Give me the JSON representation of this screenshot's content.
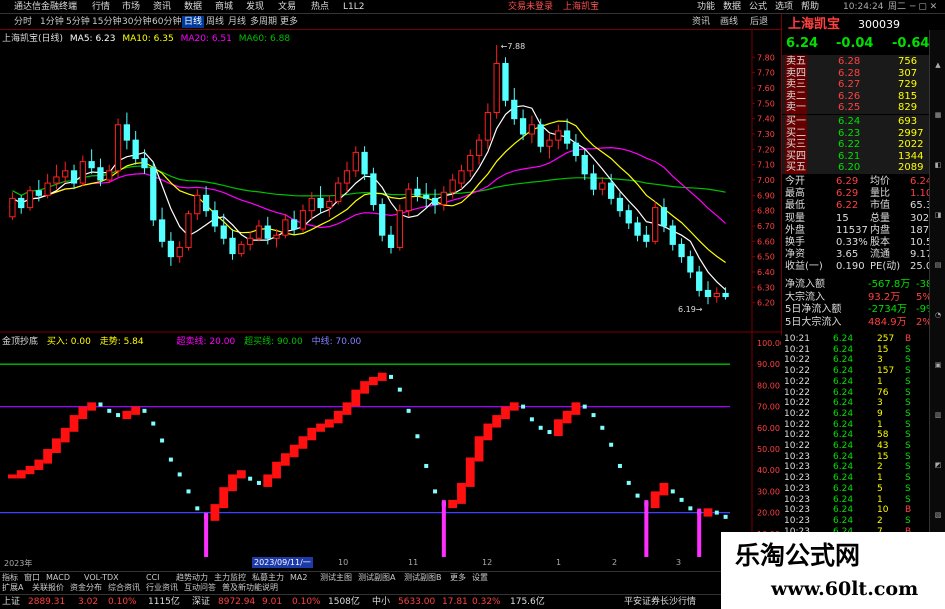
{
  "titlebar": {
    "app_name": "通达信金融终端",
    "menus": [
      "行情",
      "市场",
      "资讯",
      "数据",
      "商城",
      "发现",
      "文易",
      "热点",
      "L1L2"
    ],
    "center": [
      "交易未登录",
      "上海凯宝"
    ],
    "right": [
      "功能",
      "数据",
      "公式",
      "选项",
      "帮助"
    ],
    "time": "10:24:24",
    "weekday": "周二"
  },
  "toolbar": {
    "periods": [
      "分时",
      "1分钟",
      "5分钟",
      "15分钟",
      "30分钟",
      "60分钟",
      "日线",
      "周线",
      "月线",
      "多周期",
      "更多"
    ],
    "active": "日线",
    "right": [
      "资讯",
      "画线",
      "后退"
    ]
  },
  "chart_header": {
    "title": "上海凯宝(日线)",
    "ma5": "MA5: 6.23",
    "ma10": "MA10: 6.35",
    "ma20": "MA20: 6.51",
    "ma60": "MA60: 6.88"
  },
  "chart_data": [
    {
      "type": "candlestick",
      "symbol": "上海凯宝",
      "period": "日线",
      "ylim": [
        6.1,
        7.9
      ],
      "y_ticks": [
        "7.80",
        "7.70",
        "7.60",
        "7.50",
        "7.40",
        "7.30",
        "7.20",
        "7.10",
        "7.00",
        "6.90",
        "6.80",
        "6.70",
        "6.60",
        "6.50",
        "6.40",
        "6.30",
        "6.20"
      ],
      "annotations": {
        "high": "7.88",
        "low": "6.19"
      },
      "colors": {
        "up": "#ff2020",
        "down": "#54ffff",
        "ma5": "#ffffff",
        "ma10": "#ffff00",
        "ma20": "#ff00ff",
        "ma60": "#00c000"
      },
      "ohlc": [
        [
          6.76,
          6.92,
          6.74,
          6.88
        ],
        [
          6.88,
          6.9,
          6.78,
          6.82
        ],
        [
          6.82,
          6.96,
          6.8,
          6.93
        ],
        [
          6.93,
          7.0,
          6.86,
          6.9
        ],
        [
          6.9,
          7.04,
          6.88,
          6.98
        ],
        [
          6.98,
          7.1,
          6.94,
          7.02
        ],
        [
          7.02,
          7.12,
          6.98,
          7.06
        ],
        [
          7.06,
          7.1,
          6.94,
          6.98
        ],
        [
          6.98,
          7.16,
          6.96,
          7.12
        ],
        [
          7.12,
          7.2,
          7.04,
          7.08
        ],
        [
          7.08,
          7.14,
          6.96,
          7.0
        ],
        [
          7.0,
          7.1,
          6.98,
          7.06
        ],
        [
          7.06,
          7.4,
          7.02,
          7.36
        ],
        [
          7.36,
          7.44,
          7.2,
          7.26
        ],
        [
          7.26,
          7.32,
          7.1,
          7.14
        ],
        [
          7.14,
          7.2,
          7.04,
          7.08
        ],
        [
          7.08,
          7.12,
          6.7,
          6.74
        ],
        [
          6.74,
          6.82,
          6.56,
          6.6
        ],
        [
          6.6,
          6.66,
          6.44,
          6.5
        ],
        [
          6.5,
          6.6,
          6.46,
          6.56
        ],
        [
          6.56,
          6.8,
          6.54,
          6.78
        ],
        [
          6.78,
          6.94,
          6.74,
          6.9
        ],
        [
          6.9,
          6.96,
          6.76,
          6.8
        ],
        [
          6.8,
          6.86,
          6.66,
          6.7
        ],
        [
          6.7,
          6.78,
          6.58,
          6.62
        ],
        [
          6.62,
          6.68,
          6.48,
          6.52
        ],
        [
          6.52,
          6.6,
          6.5,
          6.58
        ],
        [
          6.58,
          6.66,
          6.54,
          6.62
        ],
        [
          6.62,
          6.74,
          6.6,
          6.7
        ],
        [
          6.7,
          6.76,
          6.58,
          6.62
        ],
        [
          6.62,
          6.68,
          6.56,
          6.64
        ],
        [
          6.64,
          6.78,
          6.62,
          6.74
        ],
        [
          6.74,
          6.8,
          6.64,
          6.68
        ],
        [
          6.68,
          6.84,
          6.66,
          6.8
        ],
        [
          6.8,
          6.92,
          6.74,
          6.88
        ],
        [
          6.88,
          6.96,
          6.78,
          6.82
        ],
        [
          6.82,
          6.9,
          6.76,
          6.86
        ],
        [
          6.86,
          7.02,
          6.84,
          6.98
        ],
        [
          6.98,
          7.12,
          6.92,
          7.06
        ],
        [
          7.06,
          7.22,
          7.02,
          7.18
        ],
        [
          7.18,
          7.22,
          7.0,
          7.04
        ],
        [
          7.04,
          7.08,
          6.8,
          6.84
        ],
        [
          6.84,
          6.88,
          6.6,
          6.64
        ],
        [
          6.64,
          6.7,
          6.52,
          6.56
        ],
        [
          6.56,
          6.84,
          6.54,
          6.8
        ],
        [
          6.8,
          6.98,
          6.76,
          6.94
        ],
        [
          6.94,
          7.02,
          6.86,
          6.9
        ],
        [
          6.9,
          6.98,
          6.82,
          6.88
        ],
        [
          6.88,
          6.94,
          6.78,
          6.84
        ],
        [
          6.84,
          6.96,
          6.8,
          6.92
        ],
        [
          6.92,
          7.04,
          6.88,
          7.0
        ],
        [
          6.98,
          7.1,
          6.94,
          7.06
        ],
        [
          7.06,
          7.2,
          7.02,
          7.16
        ],
        [
          7.16,
          7.3,
          7.1,
          7.26
        ],
        [
          7.26,
          7.5,
          7.2,
          7.44
        ],
        [
          7.44,
          7.88,
          7.4,
          7.76
        ],
        [
          7.76,
          7.8,
          7.48,
          7.52
        ],
        [
          7.52,
          7.6,
          7.36,
          7.4
        ],
        [
          7.4,
          7.46,
          7.26,
          7.3
        ],
        [
          7.3,
          7.42,
          7.24,
          7.36
        ],
        [
          7.36,
          7.4,
          7.18,
          7.22
        ],
        [
          7.22,
          7.3,
          7.14,
          7.26
        ],
        [
          7.26,
          7.36,
          7.2,
          7.32
        ],
        [
          7.32,
          7.4,
          7.2,
          7.24
        ],
        [
          7.24,
          7.3,
          7.12,
          7.16
        ],
        [
          7.16,
          7.2,
          7.0,
          7.04
        ],
        [
          7.04,
          7.1,
          6.9,
          6.94
        ],
        [
          6.94,
          7.02,
          6.9,
          6.98
        ],
        [
          6.98,
          7.04,
          6.84,
          6.88
        ],
        [
          6.88,
          6.92,
          6.76,
          6.8
        ],
        [
          6.8,
          6.84,
          6.68,
          6.72
        ],
        [
          6.72,
          6.76,
          6.6,
          6.64
        ],
        [
          6.64,
          6.7,
          6.56,
          6.6
        ],
        [
          6.6,
          6.86,
          6.58,
          6.82
        ],
        [
          6.82,
          6.88,
          6.66,
          6.7
        ],
        [
          6.7,
          6.74,
          6.54,
          6.58
        ],
        [
          6.58,
          6.62,
          6.46,
          6.5
        ],
        [
          6.5,
          6.54,
          6.36,
          6.4
        ],
        [
          6.4,
          6.44,
          6.24,
          6.28
        ],
        [
          6.28,
          6.34,
          6.19,
          6.24
        ],
        [
          6.24,
          6.3,
          6.2,
          6.26
        ],
        [
          6.26,
          6.3,
          6.22,
          6.24
        ]
      ]
    },
    {
      "type": "indicator",
      "name": "金顶抄底",
      "labels": [
        "买入: 0.00",
        "走势: 5.84",
        "超卖线: 20.00",
        "超买线: 90.00",
        "中线: 70.00"
      ],
      "header_colors": {
        "buy": "#ffff00",
        "trend": "#ffff00",
        "l20": "#ff00ff",
        "l90": "#00c000",
        "l70": "#8080ff"
      },
      "ylim": [
        0,
        100
      ],
      "y_ticks": [
        "100.00",
        "90.00",
        "80.00",
        "70.00",
        "60.00",
        "50.00",
        "40.00",
        "30.00",
        "20.00",
        "10.00"
      ],
      "lines": [
        {
          "value": 90,
          "color": "#00c000"
        },
        {
          "value": 70,
          "color": "#a000ff"
        },
        {
          "value": 20,
          "color": "#4040ff"
        }
      ],
      "trend": [
        38,
        40,
        42,
        45,
        50,
        55,
        60,
        66,
        70,
        72,
        71,
        68,
        66,
        68,
        70,
        68,
        62,
        54,
        45,
        38,
        30,
        22,
        18,
        24,
        32,
        38,
        40,
        36,
        34,
        38,
        44,
        48,
        52,
        56,
        60,
        62,
        64,
        68,
        72,
        78,
        82,
        84,
        86,
        84,
        78,
        68,
        56,
        42,
        30,
        24,
        26,
        34,
        46,
        56,
        62,
        66,
        70,
        72,
        70,
        64,
        60,
        58,
        64,
        68,
        72,
        70,
        66,
        60,
        52,
        42,
        34,
        28,
        24,
        30,
        34,
        30,
        26,
        22,
        20,
        22,
        20,
        18
      ]
    }
  ],
  "quote": {
    "name": "上海凯宝",
    "code": "300039",
    "price": "6.24",
    "change": "-0.04",
    "pct": "-0.64%",
    "sell": [
      {
        "label": "卖五",
        "price": "6.28",
        "vol": "756"
      },
      {
        "label": "卖四",
        "price": "6.28",
        "vol": "307"
      },
      {
        "label": "卖三",
        "price": "6.27",
        "vol": "729"
      },
      {
        "label": "卖二",
        "price": "6.26",
        "vol": "815"
      },
      {
        "label": "卖一",
        "price": "6.25",
        "vol": "829"
      }
    ],
    "buy": [
      {
        "label": "买一",
        "price": "6.24",
        "vol": "693"
      },
      {
        "label": "买二",
        "price": "6.23",
        "vol": "2997"
      },
      {
        "label": "买三",
        "price": "6.22",
        "vol": "2022"
      },
      {
        "label": "买四",
        "price": "6.21",
        "vol": "1344"
      },
      {
        "label": "买五",
        "price": "6.20",
        "vol": "2089"
      }
    ],
    "stats": [
      {
        "l": "今开",
        "v": "6.29",
        "l2": "均价",
        "v2": "6.24"
      },
      {
        "l": "最高",
        "v": "6.29",
        "l2": "量比",
        "v2": "1.10"
      },
      {
        "l": "最低",
        "v": "6.22",
        "l2": "市值",
        "v2": "65.3亿"
      },
      {
        "l": "现量",
        "v": "15",
        "l2": "总量",
        "v2": "30251"
      },
      {
        "l": "外盘",
        "v": "11537",
        "l2": "内盘",
        "v2": "18714"
      },
      {
        "l": "换手",
        "v": "0.33%",
        "l2": "股本",
        "v2": "10.5亿"
      },
      {
        "l": "净资",
        "v": "3.65",
        "l2": "流通",
        "v2": "9.17亿"
      },
      {
        "l": "收益(一)",
        "v": "0.190",
        "l2": "PE(动)",
        "v2": "25.0"
      }
    ],
    "flows": [
      {
        "l": "净流入额",
        "v": "-567.8万",
        "p": "-38%"
      },
      {
        "l": "大宗流入",
        "v": "93.2万",
        "p": "5%"
      },
      {
        "l": "5日净流入额",
        "v": "-2734万",
        "p": "-9%"
      },
      {
        "l": "5日大宗流入",
        "v": "484.9万",
        "p": "2%"
      }
    ]
  },
  "ticks": [
    {
      "t": "10:21",
      "p": "6.24",
      "v": "257",
      "d": "B"
    },
    {
      "t": "10:21",
      "p": "6.24",
      "v": "15",
      "d": "S"
    },
    {
      "t": "10:22",
      "p": "6.24",
      "v": "3",
      "d": "S"
    },
    {
      "t": "10:22",
      "p": "6.24",
      "v": "157",
      "d": "S"
    },
    {
      "t": "10:22",
      "p": "6.24",
      "v": "1",
      "d": "S"
    },
    {
      "t": "10:22",
      "p": "6.24",
      "v": "76",
      "d": "S"
    },
    {
      "t": "10:22",
      "p": "6.24",
      "v": "3",
      "d": "S"
    },
    {
      "t": "10:22",
      "p": "6.24",
      "v": "9",
      "d": "S"
    },
    {
      "t": "10:22",
      "p": "6.24",
      "v": "1",
      "d": "S"
    },
    {
      "t": "10:22",
      "p": "6.24",
      "v": "58",
      "d": "S"
    },
    {
      "t": "10:22",
      "p": "6.24",
      "v": "43",
      "d": "S"
    },
    {
      "t": "10:23",
      "p": "6.24",
      "v": "15",
      "d": "S"
    },
    {
      "t": "10:23",
      "p": "6.24",
      "v": "2",
      "d": "S"
    },
    {
      "t": "10:23",
      "p": "6.24",
      "v": "1",
      "d": "S"
    },
    {
      "t": "10:23",
      "p": "6.24",
      "v": "5",
      "d": "S"
    },
    {
      "t": "10:23",
      "p": "6.24",
      "v": "1",
      "d": "S"
    },
    {
      "t": "10:23",
      "p": "6.24",
      "v": "10",
      "d": "B"
    },
    {
      "t": "10:23",
      "p": "6.24",
      "v": "2",
      "d": "S"
    },
    {
      "t": "10:23",
      "p": "6.24",
      "v": "7",
      "d": "B"
    },
    {
      "t": "10:24",
      "p": "6.24",
      "v": "1",
      "d": "S"
    },
    {
      "t": "10:24",
      "p": "6.24",
      "v": "1",
      "d": "B"
    },
    {
      "t": "10:24",
      "p": "6.24",
      "v": "3",
      "d": "S"
    }
  ],
  "date_axis": [
    "2023年",
    "2023/09/11/一",
    "10",
    "11",
    "12",
    "1",
    "2",
    "3"
  ],
  "tabs": [
    "指标",
    "窗口",
    "MACD",
    "VOL-TDX",
    "CCI",
    "趋势动力",
    "主力监控",
    "私募主力",
    "MA2",
    "测试主图",
    "测试副图A",
    "测试副图B",
    "更多",
    "设置"
  ],
  "tabs2": [
    "扩展A",
    "关联报价",
    "资金分布",
    "综合资讯",
    "行业资讯",
    "互动问答",
    "普及新功能说明"
  ],
  "status": [
    {
      "name": "上证",
      "v": "2889.31",
      "c": "3.02",
      "p": "0.10%",
      "a": "1115亿"
    },
    {
      "name": "深证",
      "v": "8972.94",
      "c": "9.01",
      "p": "0.10%",
      "a": "1508亿"
    },
    {
      "name": "中小",
      "v": "5633.00",
      "c": "17.81",
      "p": "0.32%",
      "a": "175.6亿"
    }
  ],
  "status_right": "平安证券长沙行情",
  "watermark": {
    "title": "乐淘公式网",
    "url": "www.60lt.com"
  }
}
